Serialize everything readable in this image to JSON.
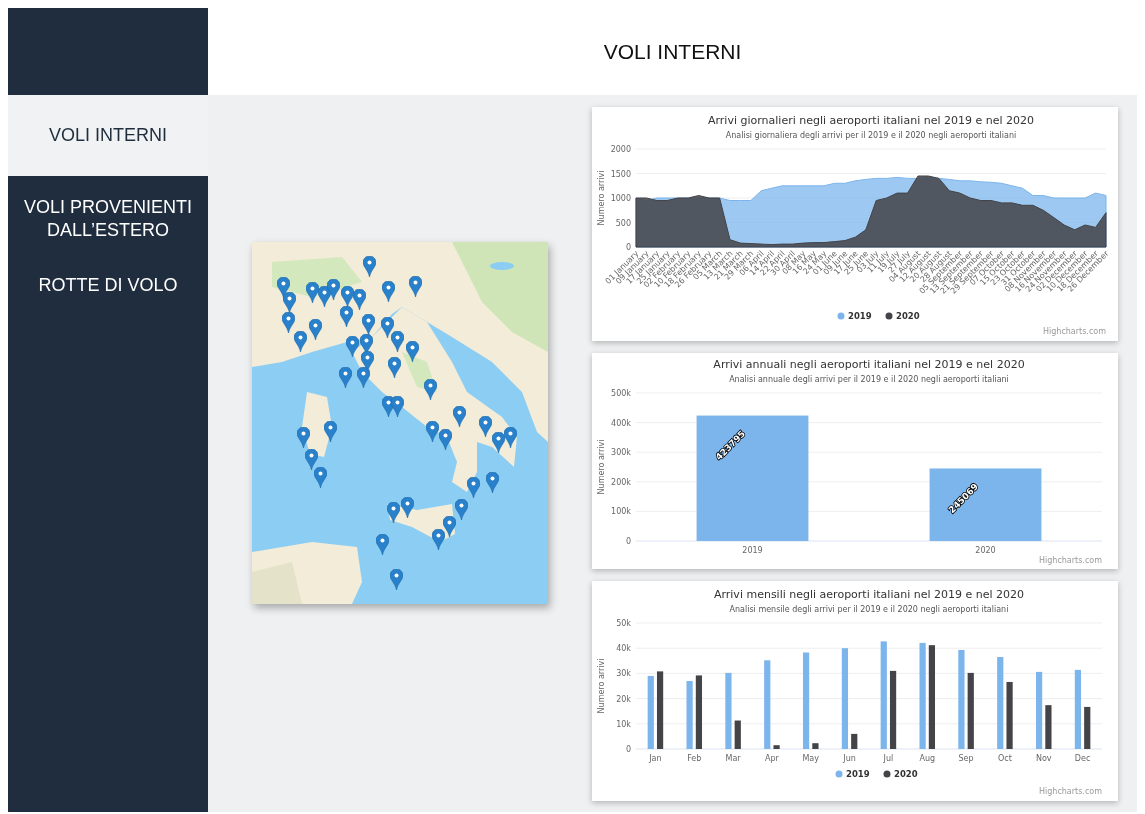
{
  "header": {
    "title": "VOLI INTERNI"
  },
  "sidebar": {
    "items": [
      {
        "label": "VOLI INTERNI",
        "selected": true
      },
      {
        "label": "VOLI PROVENIENTI DALL’ESTERO",
        "selected": false
      },
      {
        "label": "ROTTE DI VOLO",
        "selected": false
      }
    ]
  },
  "charts": [
    {
      "subtitle": "Analisi giornaliera degli arrivi per il 2019 e il 2020 negli aeroporti italiani",
      "credit": "Highcharts.com",
      "chart_data": {
        "type": "area",
        "title": "Arrivi giornalieri negli aeroporti italiani nel 2019 e nel 2020",
        "ylabel": "Numero arrivi",
        "categories": [
          "01 January",
          "09 January",
          "17 January",
          "25 January",
          "02 February",
          "10 February",
          "18 February",
          "26 February",
          "05 March",
          "13 March",
          "21 March",
          "29 March",
          "06 April",
          "14 April",
          "22 April",
          "30 April",
          "08 May",
          "16 May",
          "24 May",
          "01 June",
          "09 June",
          "17 June",
          "25 June",
          "03 July",
          "11 July",
          "19 July",
          "27 July",
          "04 August",
          "12 August",
          "20 August",
          "28 August",
          "05 September",
          "13 September",
          "21 September",
          "29 September",
          "07 October",
          "15 October",
          "23 October",
          "31 October",
          "08 November",
          "16 November",
          "24 November",
          "02 December",
          "10 December",
          "18 December",
          "26 December"
        ],
        "series": [
          {
            "name": "2019",
            "color": "#7cb5ec",
            "values": [
              1000,
              950,
              1000,
              1000,
              1000,
              1000,
              1000,
              1000,
              1000,
              950,
              950,
              950,
              1150,
              1200,
              1250,
              1250,
              1250,
              1250,
              1250,
              1300,
              1300,
              1350,
              1380,
              1400,
              1400,
              1420,
              1400,
              1400,
              1420,
              1400,
              1380,
              1350,
              1350,
              1330,
              1320,
              1300,
              1250,
              1200,
              1050,
              1050,
              1000,
              1000,
              1000,
              1000,
              1100,
              1050
            ]
          },
          {
            "name": "2020",
            "color": "#434348",
            "values": [
              1000,
              1000,
              950,
              950,
              1000,
              1000,
              1050,
              1000,
              1000,
              150,
              80,
              70,
              60,
              50,
              60,
              60,
              80,
              90,
              90,
              110,
              130,
              200,
              350,
              950,
              1000,
              1100,
              1100,
              1450,
              1450,
              1400,
              1150,
              1100,
              1000,
              950,
              950,
              900,
              900,
              850,
              850,
              750,
              600,
              450,
              350,
              450,
              400,
              700
            ]
          }
        ],
        "ylim": [
          0,
          2000
        ],
        "yticks": [
          0,
          500,
          1000,
          1500,
          2000
        ],
        "grid": true,
        "legend": true
      }
    },
    {
      "subtitle": "Analisi annuale degli arrivi per il 2019 e il 2020 negli aeroporti italiani",
      "credit": "Highcharts.com",
      "chart_data": {
        "type": "bar",
        "title": "Arrivi annuali negli aeroporti italiani nel 2019 e nel 2020",
        "ylabel": "Numero arrivi",
        "categories": [
          "2019",
          "2020"
        ],
        "series": [
          {
            "color": "#7cb5ec",
            "values": [
              423795,
              245069
            ]
          }
        ],
        "ylim": [
          0,
          500000
        ],
        "yticks": [
          {
            "value": 0,
            "label": "0"
          },
          {
            "value": 100000,
            "label": "100k"
          },
          {
            "value": 200000,
            "label": "200k"
          },
          {
            "value": 300000,
            "label": "300k"
          },
          {
            "value": 400000,
            "label": "400k"
          },
          {
            "value": 500000,
            "label": "500k"
          }
        ],
        "data_labels": true,
        "grid": true
      }
    },
    {
      "subtitle": "Analisi mensile degli arrivi per il 2019 e il 2020 negli aeroporti italiani",
      "credit": "Highcharts.com",
      "chart_data": {
        "type": "bar",
        "title": "Arrivi mensili negli aeroporti italiani nel 2019 e nel 2020",
        "ylabel": "Numero arrivi",
        "categories": [
          "Jan",
          "Feb",
          "Mar",
          "Apr",
          "May",
          "Jun",
          "Jul",
          "Aug",
          "Sep",
          "Oct",
          "Nov",
          "Dec"
        ],
        "series": [
          {
            "name": "2019",
            "color": "#7cb5ec",
            "values": [
              29000,
              27000,
              30200,
              35200,
              38300,
              40000,
              42700,
              42100,
              39300,
              36500,
              30600,
              31400
            ]
          },
          {
            "name": "2020",
            "color": "#434348",
            "values": [
              30800,
              29200,
              11300,
              1500,
              2300,
              6000,
              31000,
              41200,
              30200,
              26600,
              17400,
              16700
            ]
          }
        ],
        "ylim": [
          0,
          50000
        ],
        "yticks": [
          {
            "value": 0,
            "label": "0"
          },
          {
            "value": 10000,
            "label": "10k"
          },
          {
            "value": 20000,
            "label": "20k"
          },
          {
            "value": 30000,
            "label": "30k"
          },
          {
            "value": 40000,
            "label": "40k"
          },
          {
            "value": 50000,
            "label": "50k"
          }
        ],
        "grid": true,
        "legend": true
      }
    }
  ]
}
